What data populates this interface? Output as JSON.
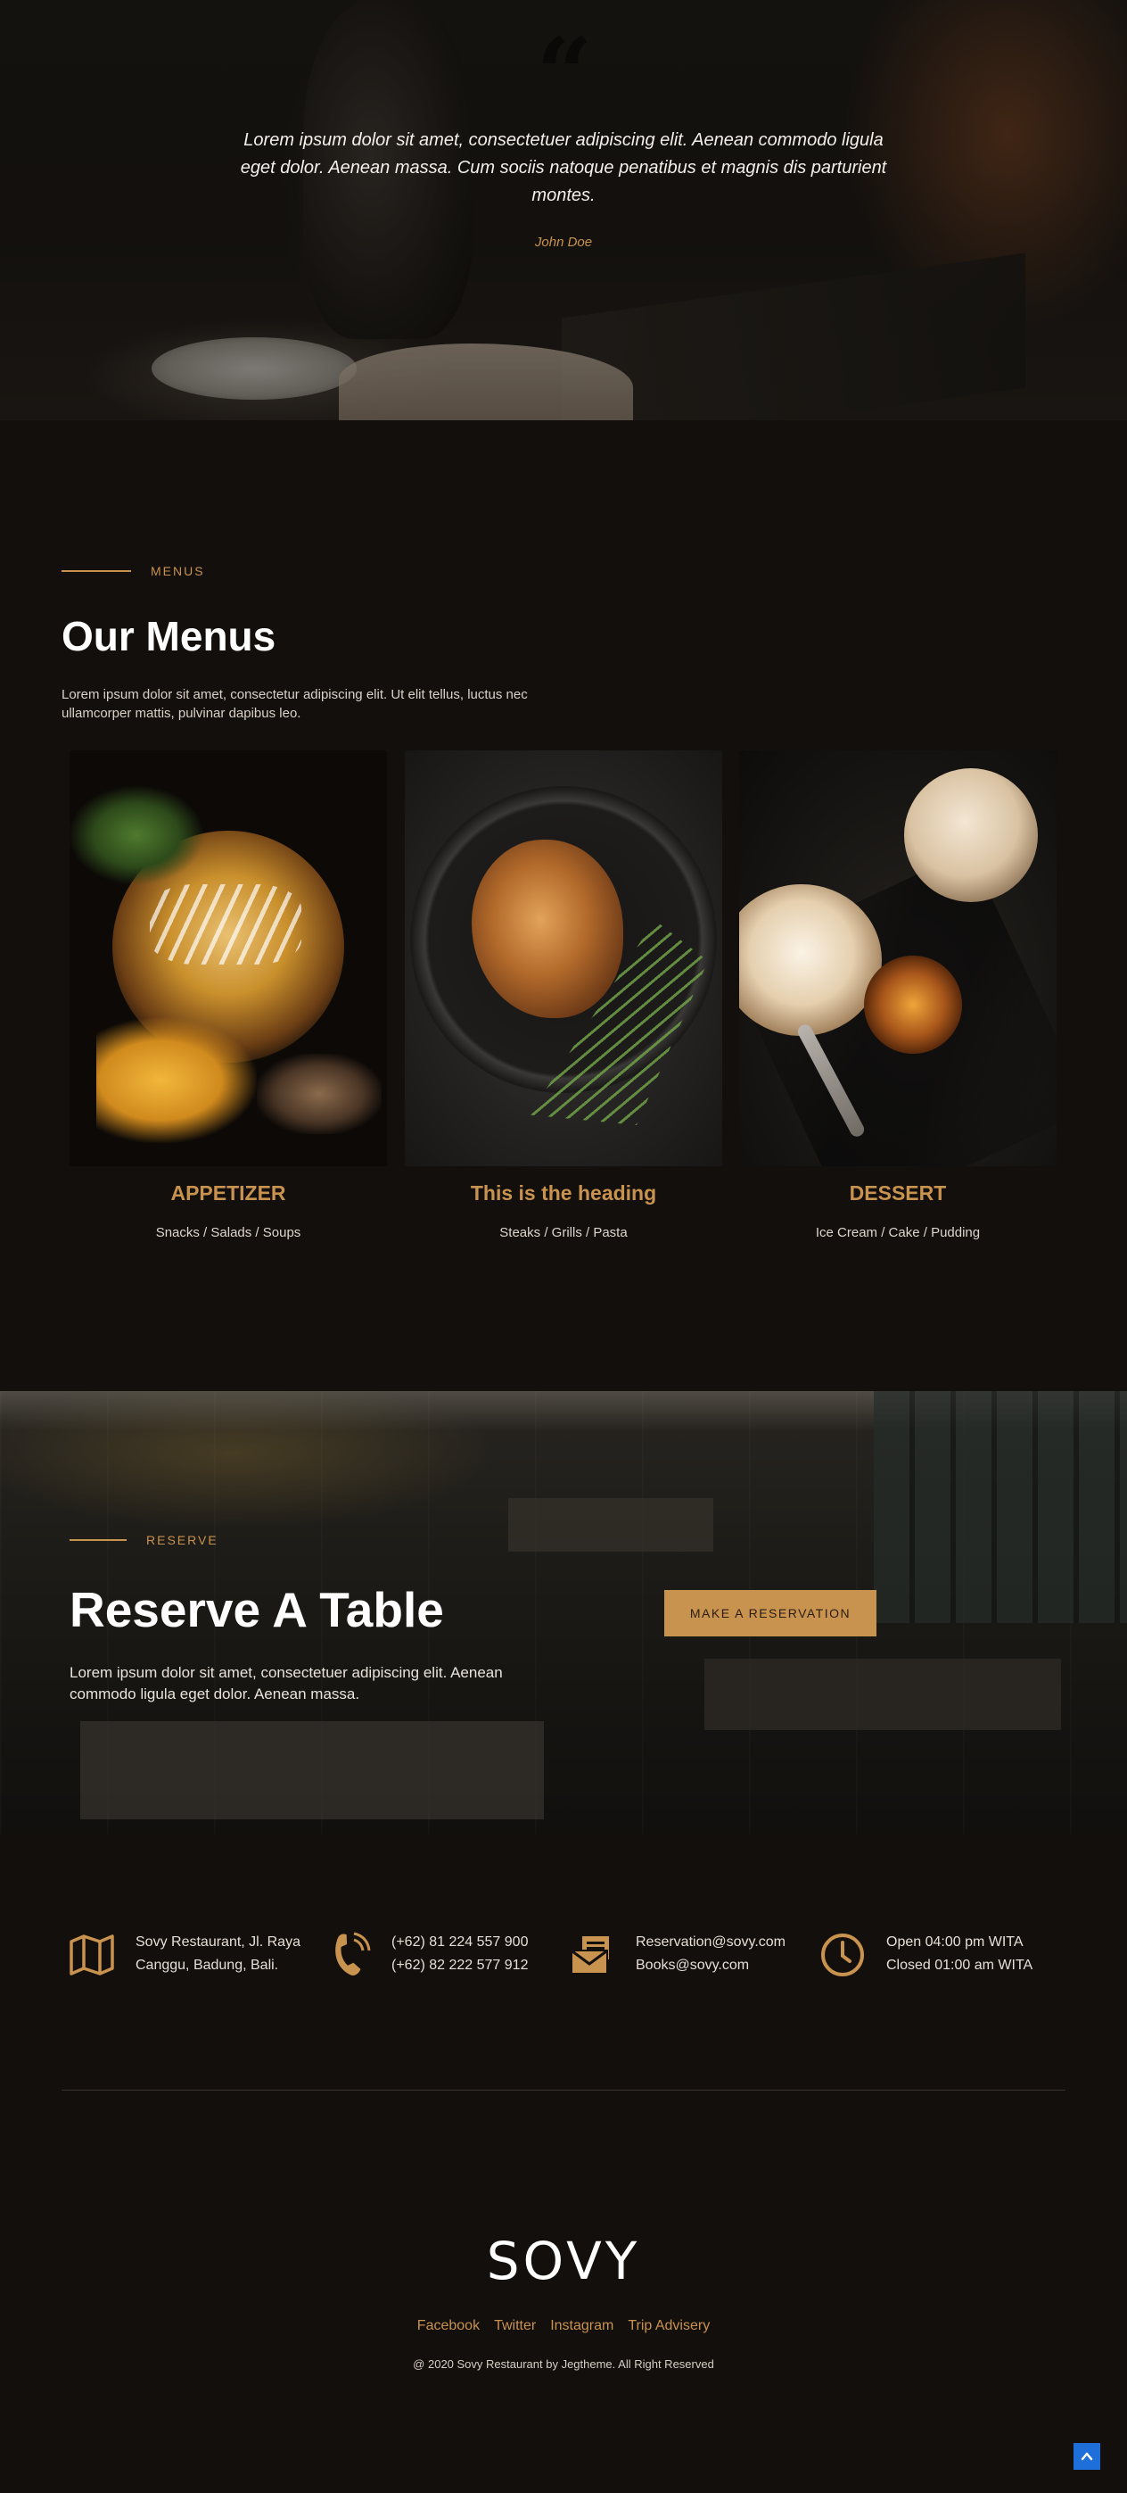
{
  "testimonial": {
    "quote": "Lorem ipsum dolor sit amet, consectetuer adipiscing elit. Aenean commodo ligula eget dolor. Aenean massa. Cum sociis natoque penatibus et magnis dis parturient montes.",
    "author": "John Doe"
  },
  "menus": {
    "eyebrow": "MENUS",
    "title": "Our Menus",
    "description": "Lorem ipsum dolor sit amet, consectetur adipiscing elit. Ut elit tellus, luctus nec ullamcorper mattis, pulvinar dapibus leo.",
    "cards": [
      {
        "name": "APPETIZER",
        "subtitle": "Snacks / Salads / Soups"
      },
      {
        "name": "This is the heading",
        "subtitle": "Steaks / Grills / Pasta"
      },
      {
        "name": "DESSERT",
        "subtitle": "Ice Cream / Cake / Pudding"
      }
    ]
  },
  "reserve": {
    "eyebrow": "RESERVE",
    "title": "Reserve A Table",
    "description": "Lorem ipsum dolor sit amet, consectetuer adipiscing elit. Aenean commodo ligula eget dolor. Aenean massa.",
    "button_label": "MAKE A RESERVATION"
  },
  "contact": [
    {
      "icon": "map-icon",
      "line1": "Sovy Restaurant, Jl. Raya",
      "line2": "Canggu, Badung, Bali."
    },
    {
      "icon": "phone-icon",
      "line1": "(+62) 81 224 557 900",
      "line2": "(+62) 82 222 577 912"
    },
    {
      "icon": "mail-icon",
      "line1": "Reservation@sovy.com",
      "line2": "Books@sovy.com"
    },
    {
      "icon": "clock-icon",
      "line1": "Open 04:00 pm WITA",
      "line2": "Closed 01:00 am WITA"
    }
  ],
  "footer": {
    "logo": "SOVY",
    "links": [
      "Facebook",
      "Twitter",
      "Instagram",
      "Trip Advisery"
    ],
    "copyright": "@ 2020 Sovy Restaurant by Jegtheme. All Right Reserved"
  },
  "colors": {
    "accent": "#c8924f",
    "background": "#130f0c",
    "back_to_top": "#1e6fd9"
  }
}
